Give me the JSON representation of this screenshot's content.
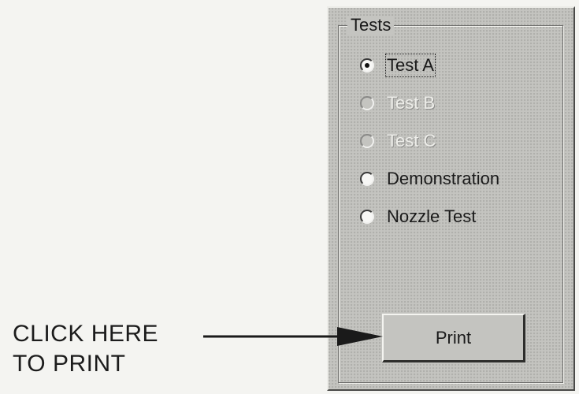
{
  "group": {
    "legend": "Tests",
    "options": [
      {
        "label": "Test A",
        "checked": true,
        "enabled": true
      },
      {
        "label": "Test B",
        "checked": false,
        "enabled": false
      },
      {
        "label": "Test C",
        "checked": false,
        "enabled": false
      },
      {
        "label": "Demonstration",
        "checked": false,
        "enabled": true
      },
      {
        "label": "Nozzle Test",
        "checked": false,
        "enabled": true
      }
    ]
  },
  "print_button": {
    "label": "Print"
  },
  "callout": {
    "line1": "CLICK HERE",
    "line2": "TO PRINT"
  }
}
